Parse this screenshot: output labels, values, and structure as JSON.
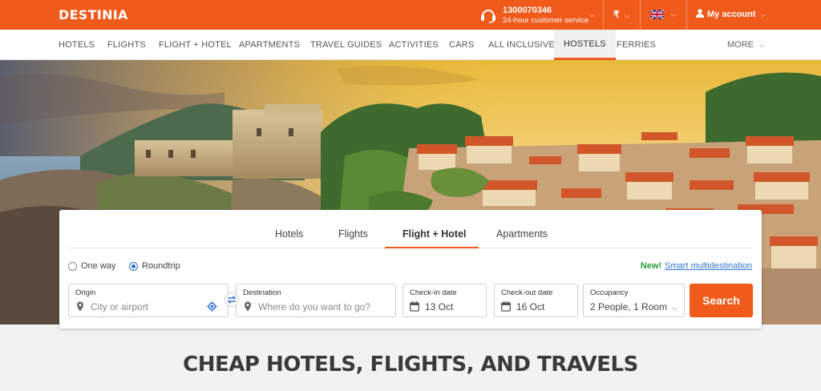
{
  "header": {
    "logo": "DESTINIA",
    "phone": "1300070346",
    "service": "24-hour customer service",
    "currency": "₹",
    "account": "My account"
  },
  "nav": {
    "items": [
      "HOTELS",
      "FLIGHTS",
      "FLIGHT + HOTEL",
      "APARTMENTS",
      "TRAVEL GUIDES",
      "ACTIVITIES",
      "CARS",
      "ALL INCLUSIVE",
      "HOSTELS",
      "FERRIES"
    ],
    "active": "HOSTELS",
    "more": "MORE"
  },
  "search": {
    "tabs": [
      "Hotels",
      "Flights",
      "Flight + Hotel",
      "Apartments"
    ],
    "active_tab": "Flight + Hotel",
    "trip_types": [
      "One way",
      "Roundtrip"
    ],
    "selected_trip": "Roundtrip",
    "new_badge": "New!",
    "multi_link": "Smart multidestination",
    "origin_label": "Origin",
    "origin_placeholder": "City or airport",
    "destination_label": "Destination",
    "destination_placeholder": "Where do you want to go?",
    "checkin_label": "Check-in date",
    "checkin_value": "13 Oct",
    "checkout_label": "Check-out date",
    "checkout_value": "16 Oct",
    "occupancy_label": "Occupancy",
    "occupancy_value": "2 People, 1 Room",
    "button": "Search"
  },
  "headline": "CHEAP HOTELS, FLIGHTS, AND TRAVELS",
  "colors": {
    "brand": "#f05a1a",
    "link": "#2f72d1",
    "new": "#2a9d3a"
  }
}
